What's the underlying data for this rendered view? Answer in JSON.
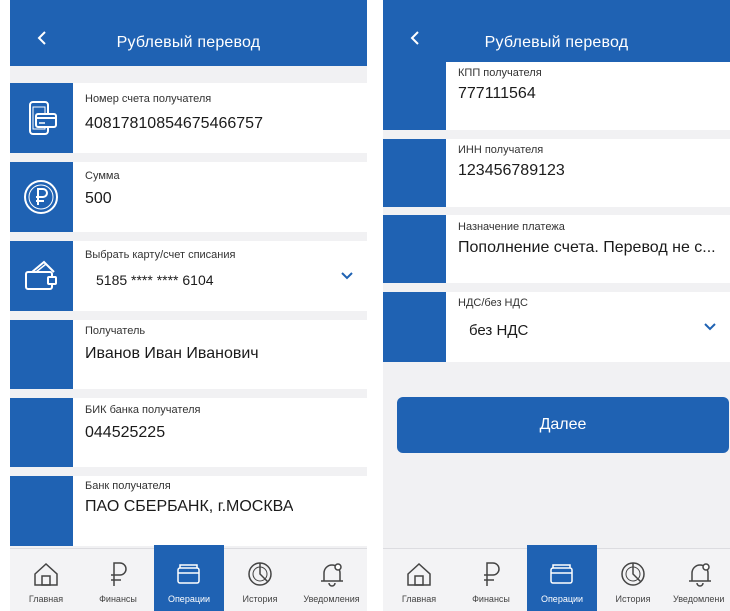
{
  "left": {
    "header": {
      "title": "Рублевый перевод"
    },
    "fields": {
      "account": {
        "label": "Номер счета получателя",
        "value": "40817810854675466757"
      },
      "amount": {
        "label": "Сумма",
        "value": "500"
      },
      "card": {
        "label": "Выбрать карту/счет списания",
        "value": "5185 **** **** 6104"
      },
      "recipient": {
        "label": "Получатель",
        "value": "Иванов Иван Иванович"
      },
      "bik": {
        "label": "БИК банка получателя",
        "value": "044525225"
      },
      "bank": {
        "label": "Банк получателя",
        "value": "ПАО СБЕРБАНК, г.МОСКВА"
      }
    }
  },
  "right": {
    "header": {
      "title": "Рублевый перевод"
    },
    "fields": {
      "kpp": {
        "label": "КПП получателя",
        "value": "777111564"
      },
      "inn": {
        "label": "ИНН получателя",
        "value": "123456789123"
      },
      "purpose": {
        "label": "Назначение платежа",
        "value": "Пополнение счета. Перевод не с..."
      },
      "vat": {
        "label": "НДС/без НДС",
        "value": "без НДС"
      }
    },
    "next_label": "Далее"
  },
  "tabbar": {
    "home": "Главная",
    "finance": "Финансы",
    "operations": "Операции",
    "history": "История",
    "notifications": "Уведомления",
    "notifications_cut": "Уведомлени"
  },
  "colors": {
    "brand": "#1f62b3",
    "background": "#f1f1f3"
  },
  "icons": {
    "back": "chevron-left-icon",
    "account": "phone-card-icon",
    "amount": "ruble-coin-icon",
    "card": "wallet-card-icon",
    "dropdown": "chevron-down-icon"
  }
}
